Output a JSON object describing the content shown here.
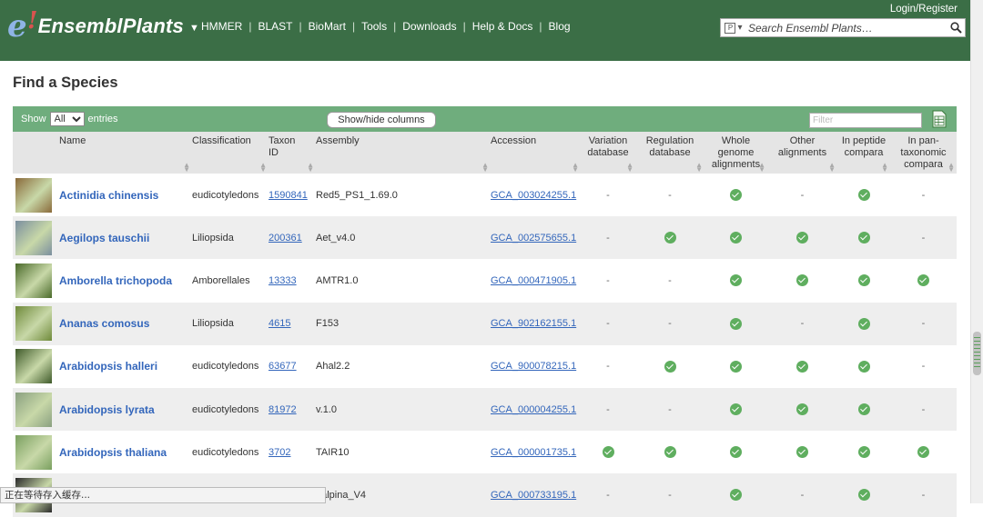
{
  "header": {
    "logo_text": "EnsemblPlants",
    "nav": [
      "HMMER",
      "BLAST",
      "BioMart",
      "Tools",
      "Downloads",
      "Help & Docs",
      "Blog"
    ],
    "login": "Login/Register",
    "search_placeholder": "Search Ensembl Plants…"
  },
  "page": {
    "title": "Find a Species"
  },
  "toolbar": {
    "show_label": "Show",
    "entries_label": "entries",
    "show_value": "All",
    "showhide_label": "Show/hide columns",
    "filter_placeholder": "Filter"
  },
  "columns": {
    "name": "Name",
    "classification": "Classification",
    "taxon": "Taxon ID",
    "assembly": "Assembly",
    "accession": "Accession",
    "variation": "Variation database",
    "regulation": "Regulation database",
    "whole_genome": "Whole genome alignments",
    "other": "Other alignments",
    "peptide": "In peptide compara",
    "pan": "In pan-taxonomic compara"
  },
  "rows": [
    {
      "name": "Actinidia chinensis",
      "classification": "eudicotyledons",
      "taxon": "1590841",
      "assembly": "Red5_PS1_1.69.0",
      "accession": "GCA_003024255.1",
      "flags": [
        false,
        false,
        true,
        false,
        true,
        false
      ],
      "img_color": "#8a6a3a"
    },
    {
      "name": "Aegilops tauschii",
      "classification": "Liliopsida",
      "taxon": "200361",
      "assembly": "Aet_v4.0",
      "accession": "GCA_002575655.1",
      "flags": [
        false,
        true,
        true,
        true,
        true,
        false
      ],
      "img_color": "#7b8f9f"
    },
    {
      "name": "Amborella trichopoda",
      "classification": "Amborellales",
      "taxon": "13333",
      "assembly": "AMTR1.0",
      "accession": "GCA_000471905.1",
      "flags": [
        false,
        false,
        true,
        true,
        true,
        true
      ],
      "img_color": "#4a6a2a"
    },
    {
      "name": "Ananas comosus",
      "classification": "Liliopsida",
      "taxon": "4615",
      "assembly": "F153",
      "accession": "GCA_902162155.1",
      "flags": [
        false,
        false,
        true,
        false,
        true,
        false
      ],
      "img_color": "#6f8a3a"
    },
    {
      "name": "Arabidopsis halleri",
      "classification": "eudicotyledons",
      "taxon": "63677",
      "assembly": "Ahal2.2",
      "accession": "GCA_900078215.1",
      "flags": [
        false,
        true,
        true,
        true,
        true,
        false
      ],
      "img_color": "#3f5a2a"
    },
    {
      "name": "Arabidopsis lyrata",
      "classification": "eudicotyledons",
      "taxon": "81972",
      "assembly": "v.1.0",
      "accession": "GCA_000004255.1",
      "flags": [
        false,
        false,
        true,
        true,
        true,
        false
      ],
      "img_color": "#8aa080"
    },
    {
      "name": "Arabidopsis thaliana",
      "classification": "eudicotyledons",
      "taxon": "3702",
      "assembly": "TAIR10",
      "accession": "GCA_000001735.1",
      "flags": [
        true,
        true,
        true,
        true,
        true,
        true
      ],
      "img_color": "#7aa060"
    },
    {
      "name": "",
      "classification": "",
      "taxon": "",
      "assembly": "_alpina_V4",
      "accession": "GCA_000733195.1",
      "flags": [
        false,
        false,
        true,
        false,
        true,
        false
      ],
      "img_color": "#2a2a2a"
    }
  ],
  "status_bar": "正在等待存入缓存..."
}
